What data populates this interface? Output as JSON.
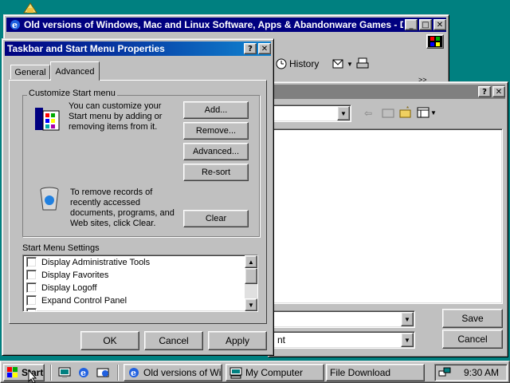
{
  "desktop": {
    "color": "#008080"
  },
  "browser": {
    "title": "Old versions of Windows, Mac and Linux Software, Apps & Abandonware Games - D...",
    "history_label": "History"
  },
  "file_dialog": {
    "save_label": "Save",
    "cancel_label": "Cancel",
    "type_field_fragment": "nt"
  },
  "props_dialog": {
    "title": "Taskbar and Start Menu Properties",
    "tabs": [
      "General",
      "Advanced"
    ],
    "active_tab": "Advanced",
    "customize_group_label": "Customize Start menu",
    "customize_text": "You can customize your Start menu by adding or removing items from it.",
    "add_button": "Add...",
    "remove_button": "Remove...",
    "advanced_button": "Advanced...",
    "resort_button": "Re-sort",
    "clear_text": "To remove records of recently accessed documents, programs, and Web sites,  click Clear.",
    "clear_button": "Clear",
    "settings_label": "Start Menu Settings",
    "settings_items": [
      {
        "label": "Display Administrative Tools",
        "checked": false
      },
      {
        "label": "Display Favorites",
        "checked": false
      },
      {
        "label": "Display Logoff",
        "checked": false
      },
      {
        "label": "Expand Control Panel",
        "checked": false
      }
    ],
    "ok_button": "OK",
    "cancel_button": "Cancel",
    "apply_button": "Apply"
  },
  "taskbar": {
    "start_label": "Start",
    "tasks": [
      "Old versions of Wi...",
      "My Computer",
      "File Download"
    ],
    "clock": "9:30 AM"
  },
  "colors": {
    "title_active_start": "#000080",
    "title_active_end": "#1084d0",
    "face": "#c0c0c0"
  }
}
